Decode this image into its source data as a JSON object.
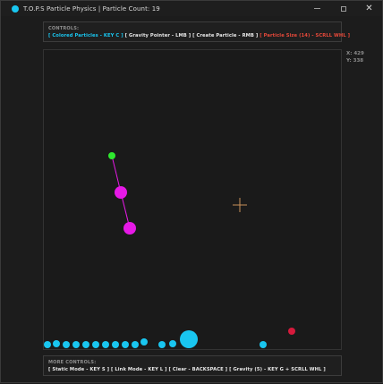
{
  "window": {
    "title": "T.O.P.S Particle Physics | Particle Count: 19",
    "icon_color": "#19c6f0",
    "buttons": {
      "minimize": "",
      "maximize": "",
      "close": "✕"
    }
  },
  "controls_panel": {
    "title": "CONTROLS:",
    "items": [
      {
        "label": "[ Colored Particles - KEY C ]",
        "color": "#19c6f0"
      },
      {
        "label": "[ Gravity Pointer - LMB ]",
        "color": "#e8e8e8"
      },
      {
        "label": "[ Create Particle - RMB ]",
        "color": "#e8e8e8"
      },
      {
        "label": "[ Particle Size (14) - SCRLL WHL ]",
        "color": "#e8493a"
      }
    ]
  },
  "more_controls_panel": {
    "title": "MORE CONTROLS:",
    "items": [
      {
        "label": "[ Static Mode - KEY S ]",
        "color": "#e8e8e8"
      },
      {
        "label": "[ Link Mode - KEY L ]",
        "color": "#e8e8e8"
      },
      {
        "label": "[ Clear - BACKSPACE ]",
        "color": "#e8e8e8"
      },
      {
        "label": "[ Gravity (5) - KEY G + SCRLL WHL ]",
        "color": "#e8e8e8"
      }
    ]
  },
  "cursor_readout": {
    "x": "X: 429",
    "y": "Y: 338"
  },
  "colors": {
    "particle_blue": "#19c6f0",
    "particle_magenta": "#e619e6",
    "particle_green": "#2ee82e",
    "particle_red": "#d61a3c",
    "crosshair": "#c8905a"
  }
}
